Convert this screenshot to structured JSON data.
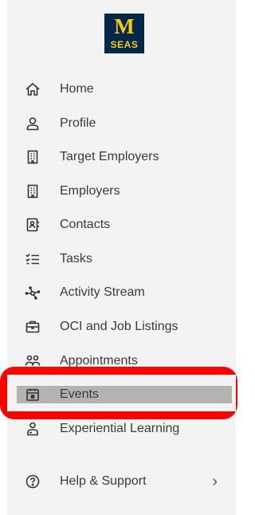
{
  "logo": {
    "top": "M",
    "bottom": "SEAS"
  },
  "nav": {
    "items": [
      {
        "label": "Home",
        "icon": "home-icon"
      },
      {
        "label": "Profile",
        "icon": "person-icon"
      },
      {
        "label": "Target Employers",
        "icon": "building-icon"
      },
      {
        "label": "Employers",
        "icon": "building-icon"
      },
      {
        "label": "Contacts",
        "icon": "contact-card-icon"
      },
      {
        "label": "Tasks",
        "icon": "checklist-icon"
      },
      {
        "label": "Activity Stream",
        "icon": "network-icon"
      },
      {
        "label": "OCI and Job Listings",
        "icon": "briefcase-icon"
      },
      {
        "label": "Appointments",
        "icon": "people-icon"
      },
      {
        "label": "Events",
        "icon": "calendar-icon",
        "active": true
      },
      {
        "label": "Experiential Learning",
        "icon": "person-badge-icon"
      }
    ],
    "help": {
      "label": "Help & Support",
      "icon": "question-icon",
      "chevron": "›"
    }
  },
  "colors": {
    "logo_bg": "#00274c",
    "logo_fg": "#ffcb05",
    "highlight": "#ff0000",
    "active_bg": "#b3b3b3"
  }
}
